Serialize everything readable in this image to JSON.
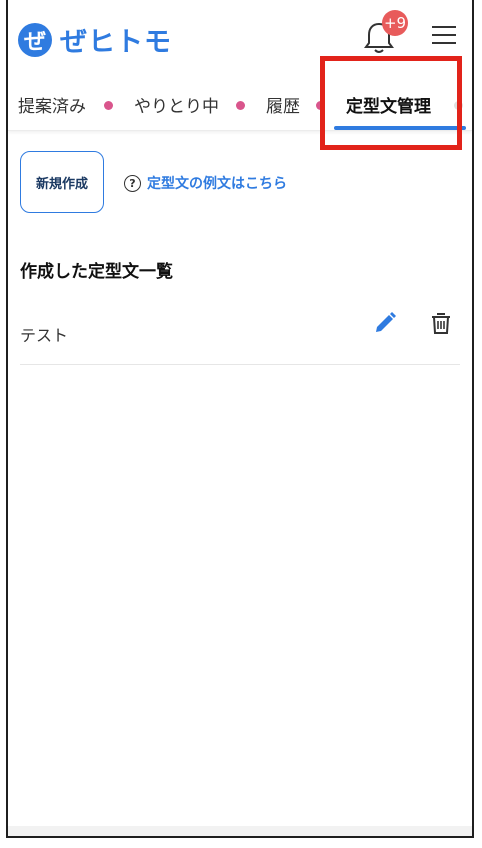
{
  "app": {
    "logo_mark": "ぜ",
    "logo_text": "ぜヒトモ"
  },
  "header": {
    "notification_badge": "+9",
    "bell_icon": "bell-icon",
    "menu_icon": "hamburger-menu-icon"
  },
  "tabs": [
    {
      "label": "提案済み"
    },
    {
      "label": "やりとり中"
    },
    {
      "label": "履歴"
    },
    {
      "label": "定型文管理",
      "active": true
    }
  ],
  "colors": {
    "brand": "#2f7be0",
    "dot": "#d9558c",
    "badge": "#e85b5b",
    "highlight": "#e2231a"
  },
  "actions": {
    "new_button_label": "新規作成",
    "help_link_label": "定型文の例文はこちら",
    "help_icon": "?"
  },
  "list": {
    "title": "作成した定型文一覧",
    "items": [
      {
        "label": "テスト",
        "edit_icon": "pencil-icon",
        "delete_icon": "trash-icon"
      }
    ]
  }
}
